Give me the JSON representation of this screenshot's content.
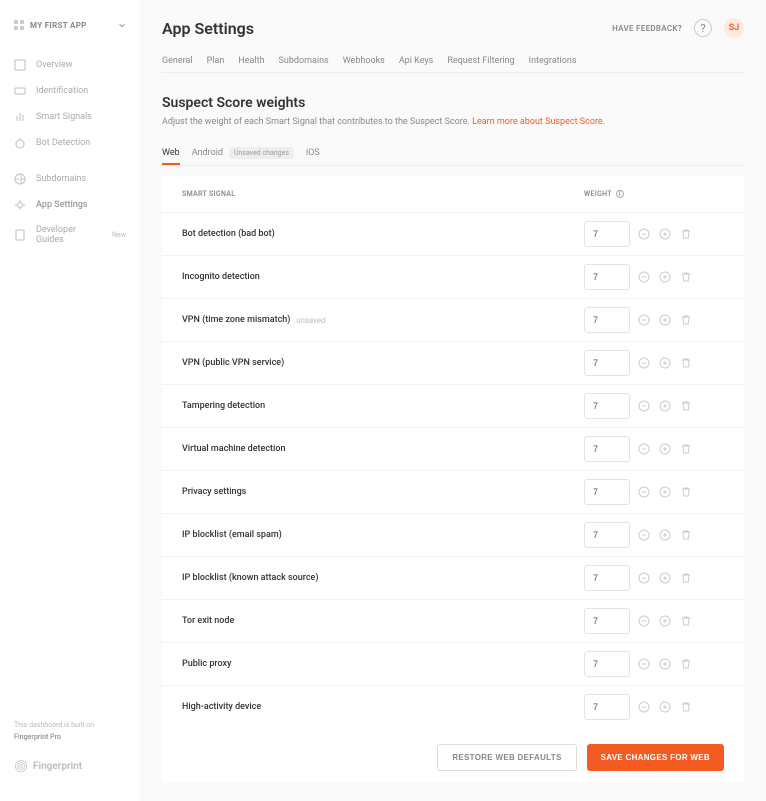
{
  "app_selector": {
    "label": "MY FIRST APP"
  },
  "sidebar": {
    "items": [
      {
        "label": "Overview",
        "icon": "overview"
      },
      {
        "label": "Identification",
        "icon": "id"
      },
      {
        "label": "Smart Signals",
        "icon": "signals"
      },
      {
        "label": "Bot Detection",
        "icon": "bot"
      },
      {
        "label": "Subdomains",
        "icon": "subdomains"
      },
      {
        "label": "App Settings",
        "icon": "settings",
        "active": true
      },
      {
        "label": "Developer Guides",
        "icon": "docs",
        "badge": "New"
      }
    ],
    "powered": "This dashboard is built on",
    "powered_brand": "Fingerprint Pro",
    "brand": "Fingerprint"
  },
  "header": {
    "title": "App Settings",
    "feedback": "HAVE FEEDBACK?",
    "avatar": "SJ"
  },
  "tabs": [
    "General",
    "Plan",
    "Health",
    "Subdomains",
    "Webhooks",
    "Api Keys",
    "Request Filtering",
    "Integrations"
  ],
  "section": {
    "title": "Suspect Score weights",
    "desc_pre": "Adjust the weight of each Smart Signal that contributes to the Suspect Score. ",
    "desc_link": "Learn more about Suspect Score",
    "desc_post": "."
  },
  "subtabs": [
    {
      "label": "Web",
      "active": true
    },
    {
      "label": "Android",
      "badge": "Unsaved changes"
    },
    {
      "label": "iOS"
    }
  ],
  "table": {
    "head_signal": "SMART SIGNAL",
    "head_weight": "WEIGHT",
    "rows": [
      {
        "label": "Bot detection (bad bot)",
        "value": "7"
      },
      {
        "label": "Incognito detection",
        "value": "7"
      },
      {
        "label": "VPN (time zone mismatch)",
        "value": "7",
        "unsaved": "unsaved"
      },
      {
        "label": "VPN (public VPN service)",
        "value": "7"
      },
      {
        "label": "Tampering detection",
        "value": "7"
      },
      {
        "label": "Virtual machine detection",
        "value": "7"
      },
      {
        "label": "Privacy settings",
        "value": "7"
      },
      {
        "label": "IP blocklist (email spam)",
        "value": "7"
      },
      {
        "label": "IP blocklist (known attack source)",
        "value": "7"
      },
      {
        "label": "Tor exit node",
        "value": "7"
      },
      {
        "label": "Public proxy",
        "value": "7"
      },
      {
        "label": "High-activity device",
        "value": "7"
      }
    ]
  },
  "actions": {
    "restore": "RESTORE WEB DEFAULTS",
    "save": "SAVE CHANGES FOR WEB"
  }
}
